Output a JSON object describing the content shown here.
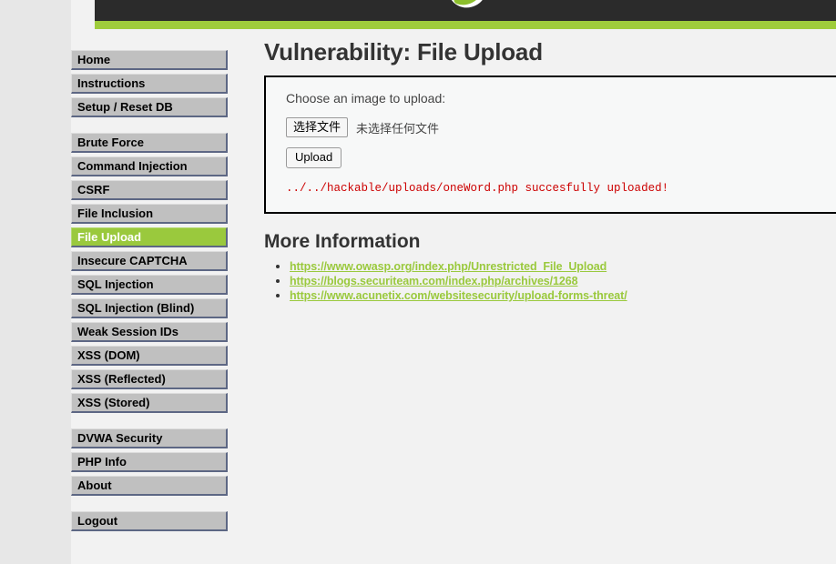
{
  "header": {
    "logo_icon": "dvwa-swirl-logo",
    "bar_color": "#9fcc3b",
    "background_color": "#2b2b2b"
  },
  "sidebar": {
    "active_color": "#9ac93d",
    "groups": [
      {
        "items": [
          {
            "label": "Home",
            "active": false
          },
          {
            "label": "Instructions",
            "active": false
          },
          {
            "label": "Setup / Reset DB",
            "active": false
          }
        ]
      },
      {
        "items": [
          {
            "label": "Brute Force",
            "active": false
          },
          {
            "label": "Command Injection",
            "active": false
          },
          {
            "label": "CSRF",
            "active": false
          },
          {
            "label": "File Inclusion",
            "active": false
          },
          {
            "label": "File Upload",
            "active": true
          },
          {
            "label": "Insecure CAPTCHA",
            "active": false
          },
          {
            "label": "SQL Injection",
            "active": false
          },
          {
            "label": "SQL Injection (Blind)",
            "active": false
          },
          {
            "label": "Weak Session IDs",
            "active": false
          },
          {
            "label": "XSS (DOM)",
            "active": false
          },
          {
            "label": "XSS (Reflected)",
            "active": false
          },
          {
            "label": "XSS (Stored)",
            "active": false
          }
        ]
      },
      {
        "items": [
          {
            "label": "DVWA Security",
            "active": false
          },
          {
            "label": "PHP Info",
            "active": false
          },
          {
            "label": "About",
            "active": false
          }
        ]
      },
      {
        "items": [
          {
            "label": "Logout",
            "active": false
          }
        ]
      }
    ]
  },
  "main": {
    "page_title": "Vulnerability: File Upload",
    "upload_form": {
      "label": "Choose an image to upload:",
      "file_button_label": "选择文件",
      "file_chosen_text": "未选择任何文件",
      "submit_label": "Upload",
      "message": "../../hackable/uploads/oneWord.php succesfully uploaded!",
      "message_color": "#cc0000"
    },
    "more_information": {
      "heading": "More Information",
      "links": [
        "https://www.owasp.org/index.php/Unrestricted_File_Upload",
        "https://blogs.securiteam.com/index.php/archives/1268",
        "https://www.acunetix.com/websitesecurity/upload-forms-threat/"
      ]
    }
  }
}
